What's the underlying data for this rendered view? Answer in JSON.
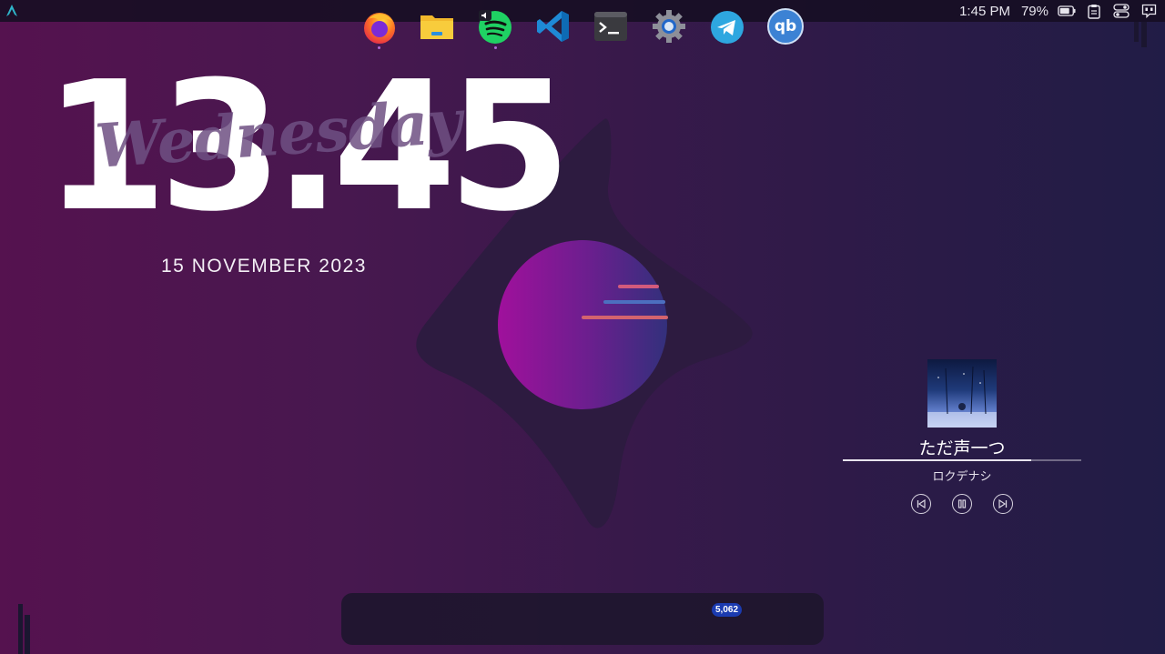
{
  "topbar": {
    "time": "1:45 PM",
    "battery_percent": "79%",
    "battery_level": 0.79,
    "icons": [
      "arch-launcher-icon",
      "battery-icon",
      "clipboard-icon",
      "toggles-icon",
      "notifications-icon"
    ]
  },
  "clock": {
    "time": "13.45",
    "weekday": "Wednesday",
    "date": "15 NOVEMBER 2023"
  },
  "player": {
    "title": "ただ声一つ",
    "artist": "ロクデナシ",
    "progress": 0.79,
    "controls": [
      "previous-icon",
      "pause-icon",
      "next-icon"
    ]
  },
  "dock": {
    "apps": [
      {
        "name": "firefox",
        "running": true
      },
      {
        "name": "files",
        "running": false
      },
      {
        "name": "spotify",
        "running": true
      },
      {
        "name": "vscode",
        "running": false
      },
      {
        "name": "terminal",
        "running": false
      },
      {
        "name": "settings",
        "running": false
      },
      {
        "name": "telegram",
        "running": false,
        "badge": "5,062"
      },
      {
        "name": "qbittorrent",
        "running": false,
        "label": "qb"
      }
    ]
  },
  "colors": {
    "accent": "#b06ad6",
    "logo_circle_start": "#9d139b",
    "logo_circle_end": "#3a2c7e"
  }
}
